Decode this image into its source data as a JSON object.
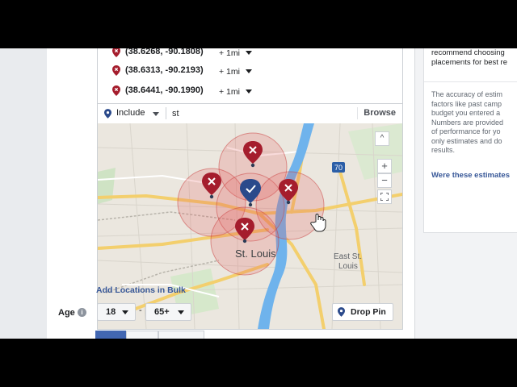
{
  "locations": {
    "rows": [
      {
        "coord": "(38.6268, -90.1808)",
        "radius": "+ 1mi"
      },
      {
        "coord": "(38.6313, -90.2193)",
        "radius": "+ 1mi"
      },
      {
        "coord": "(38.6441, -90.1990)",
        "radius": "+ 1mi"
      }
    ]
  },
  "include_bar": {
    "mode": "Include",
    "search_value": "st",
    "browse": "Browse"
  },
  "map": {
    "city_label": "St. Louis",
    "east_label_1": "East St.",
    "east_label_2": "Louis",
    "highway": "70",
    "drop_pin": "Drop Pin",
    "zoom_in": "+",
    "zoom_out": "−",
    "collapse": "^",
    "pin_colors": {
      "excluded": "#a51d2d",
      "included": "#2b4a8b"
    }
  },
  "add_bulk": "Add Locations in Bulk",
  "age": {
    "label": "Age",
    "min": "18",
    "dash": "-",
    "max": "65+"
  },
  "sidebar": {
    "top_lines": [
      "recommend choosing",
      "placements for best re"
    ],
    "body_lines": [
      "The accuracy of estim",
      "factors like past camp",
      "budget you entered a",
      "Numbers are provided",
      "of performance for yo",
      "only estimates and do",
      "results."
    ],
    "feedback_link": "Were these estimates"
  }
}
